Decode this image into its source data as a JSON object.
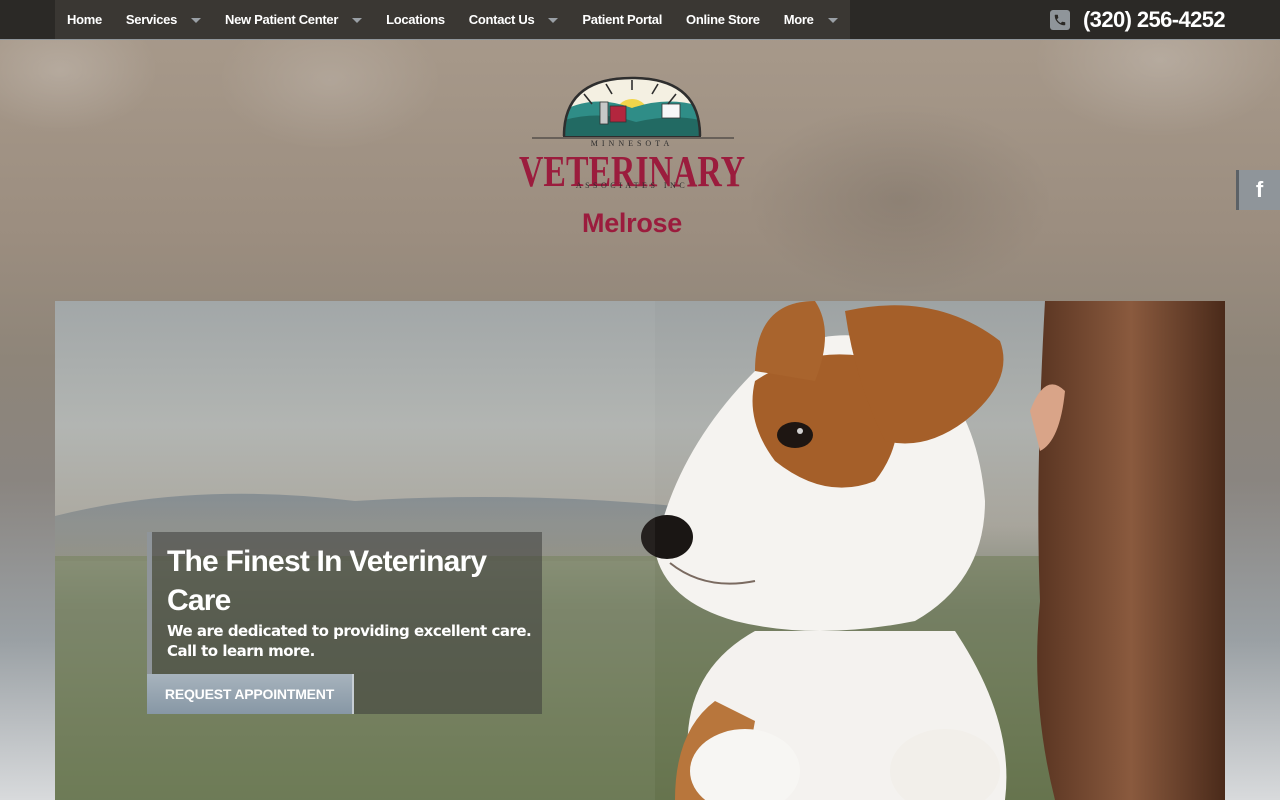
{
  "nav": {
    "items": [
      {
        "label": "Home",
        "dropdown": false
      },
      {
        "label": "Services",
        "dropdown": true
      },
      {
        "label": "New Patient Center",
        "dropdown": true
      },
      {
        "label": "Locations",
        "dropdown": false
      },
      {
        "label": "Contact Us",
        "dropdown": true
      },
      {
        "label": "Patient Portal",
        "dropdown": false
      },
      {
        "label": "Online Store",
        "dropdown": false
      },
      {
        "label": "More",
        "dropdown": true
      }
    ],
    "phone": "(320) 256-4252"
  },
  "logo": {
    "top_text": "MINNESOTA",
    "main_text": "VETERINARY",
    "bottom_text": "ASSOCIATES INC",
    "location": "Melrose"
  },
  "social": {
    "facebook": "f"
  },
  "hero": {
    "title": "The Finest In Veterinary Care",
    "text": "We are dedicated to providing excellent care. Call to learn more.",
    "button": "REQUEST APPOINTMENT"
  },
  "colors": {
    "brand": "#9b1c3d",
    "nav_bg": "#2b2926",
    "accent_gray": "#8f959a"
  }
}
